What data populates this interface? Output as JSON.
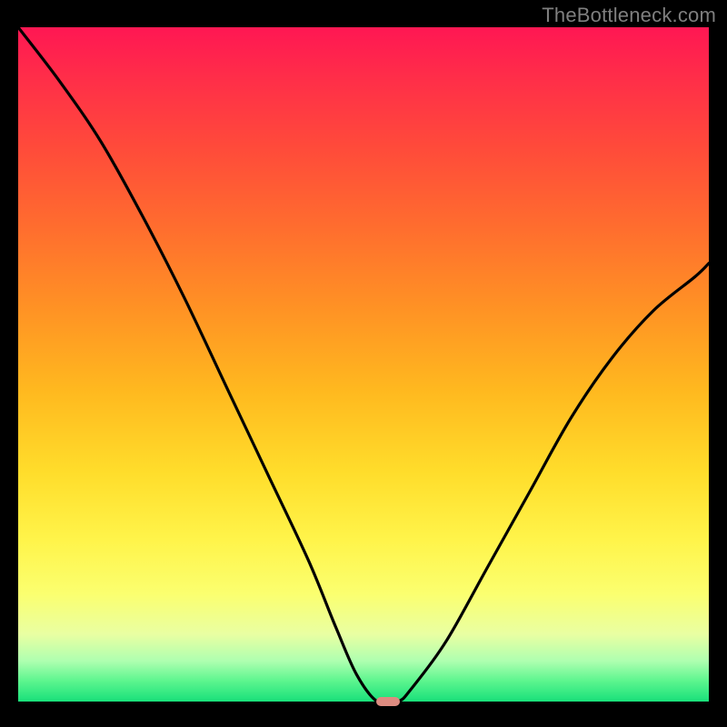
{
  "watermark": "TheBottleneck.com",
  "chart_data": {
    "type": "line",
    "title": "",
    "xlabel": "",
    "ylabel": "",
    "xlim": [
      0,
      100
    ],
    "ylim": [
      0,
      100
    ],
    "grid": false,
    "legend": false,
    "background_gradient": {
      "direction": "vertical",
      "stops": [
        {
          "pos": 0,
          "color": "#ff1753"
        },
        {
          "pos": 18,
          "color": "#ff4b3a"
        },
        {
          "pos": 42,
          "color": "#ff9324"
        },
        {
          "pos": 66,
          "color": "#ffdd2b"
        },
        {
          "pos": 84,
          "color": "#fbff6f"
        },
        {
          "pos": 97,
          "color": "#5bf58e"
        },
        {
          "pos": 100,
          "color": "#18e07a"
        }
      ]
    },
    "series": [
      {
        "name": "bottleneck-curve",
        "x": [
          0,
          6,
          12,
          18,
          24,
          30,
          36,
          42,
          46,
          49,
          52,
          55,
          57,
          62,
          68,
          74,
          80,
          86,
          92,
          98,
          100
        ],
        "y": [
          100,
          92,
          83,
          72,
          60,
          47,
          34,
          21,
          11,
          4,
          0,
          0,
          2,
          9,
          20,
          31,
          42,
          51,
          58,
          63,
          65
        ]
      }
    ],
    "marker": {
      "name": "optimal-point",
      "x": 53.5,
      "y": 0,
      "color": "#dd8b80",
      "shape": "pill"
    }
  }
}
